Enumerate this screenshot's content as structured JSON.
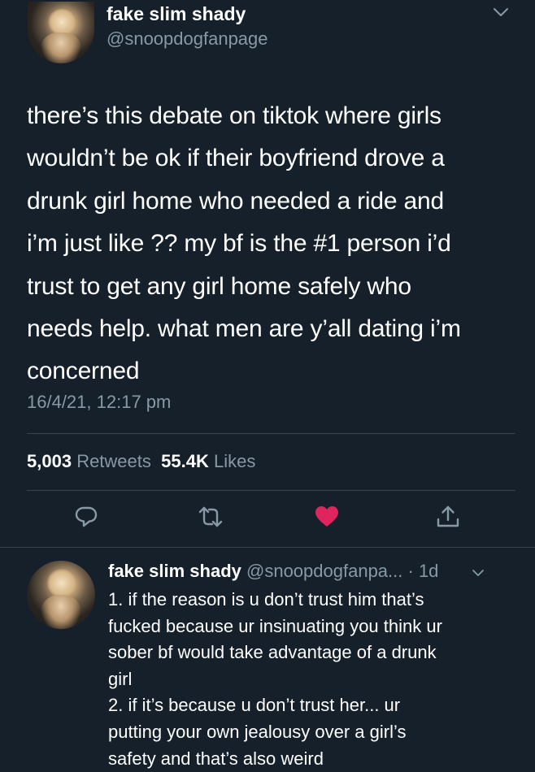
{
  "tweet": {
    "author_name": "fake slim shady",
    "author_handle": "@snoopdogfanpage",
    "text_lines": [
      "there’s this debate on tiktok where girls",
      "wouldn’t be ok if their boyfriend drove a",
      "drunk girl home who needed a ride and",
      "i’m just like ?? my bf is the #1 person i’d",
      "trust to get any girl home safely who",
      "needs help. what men are y’all dating i’m",
      "concerned"
    ],
    "timestamp": "16/4/21, 12:17 pm",
    "retweets_count": "5,003",
    "retweets_label": "Retweets",
    "likes_count": "55.4K",
    "likes_label": "Likes",
    "liked": true,
    "like_color": "#e0245e"
  },
  "actions": {
    "icons": [
      "reply-icon",
      "retweet-icon",
      "like-icon",
      "share-icon"
    ]
  },
  "reply": {
    "author_name": "fake slim shady",
    "author_handle": "@snoopdogfanpa...",
    "age": "· 1d",
    "lines": [
      "1. if the reason is u don’t trust him that’s",
      "fucked because ur insinuating you think ur",
      "sober bf would take advantage of a drunk",
      "girl",
      "2. if it’s because u don’t trust her... ur",
      "putting your own jealousy over a girl’s",
      "safety and that’s also weird"
    ]
  },
  "colors": {
    "background": "#15202b",
    "secondary_text": "#8899a6",
    "divider": "#38444d"
  }
}
